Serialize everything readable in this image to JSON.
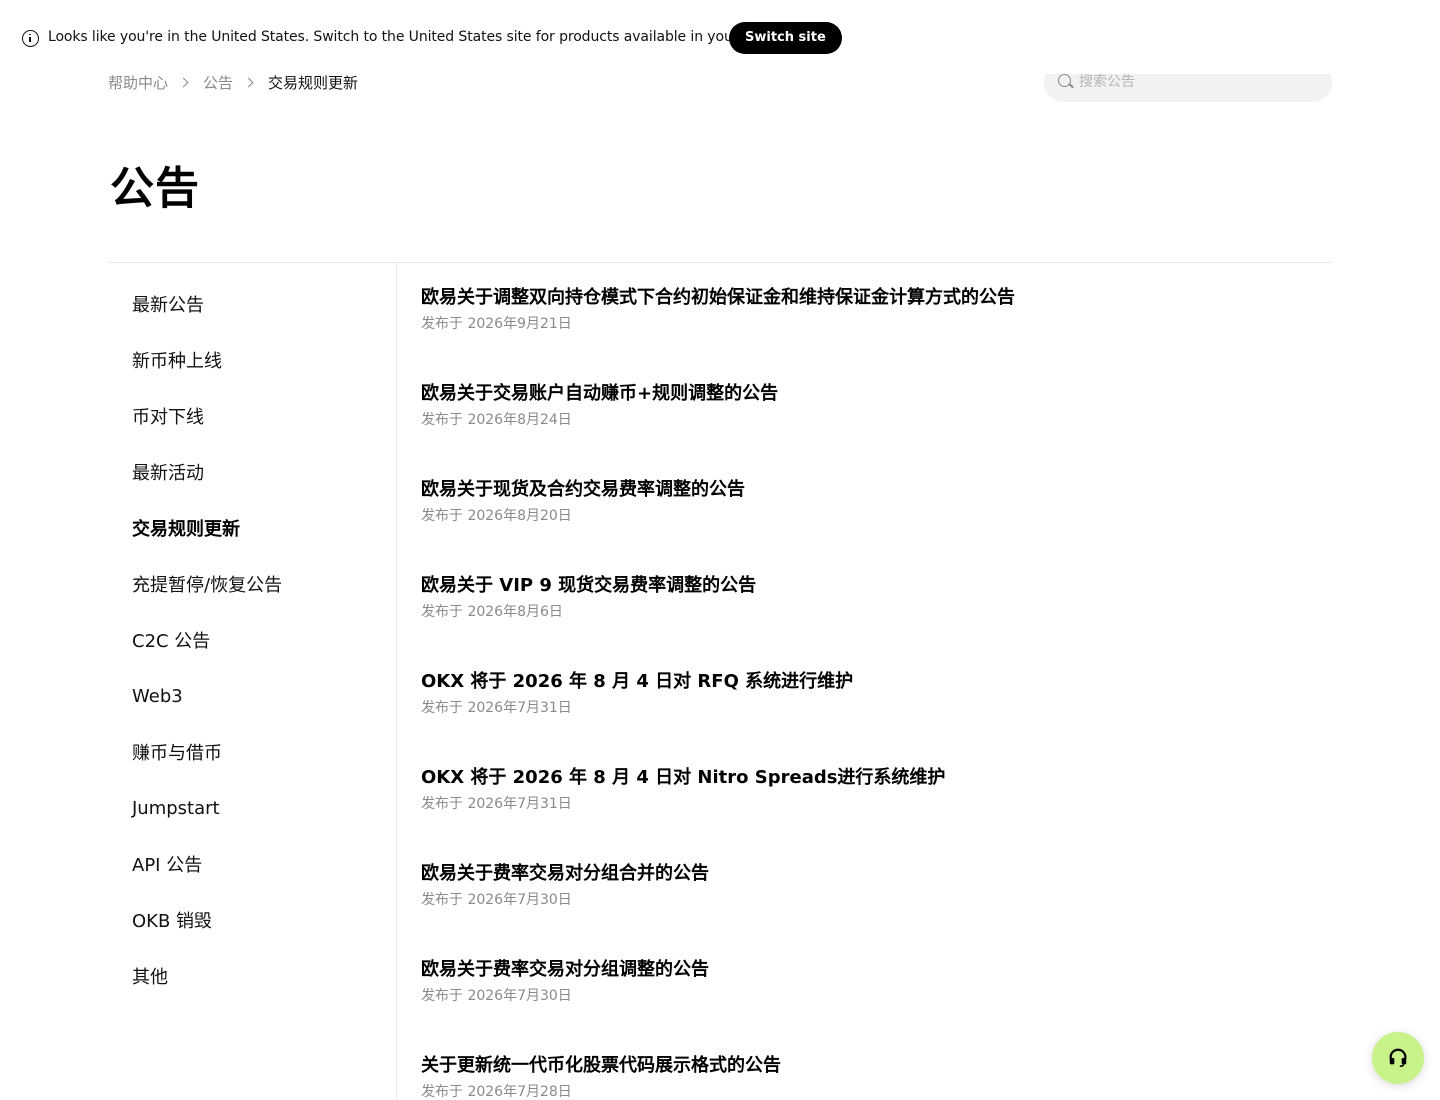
{
  "banner": {
    "text": "Looks like you're in the United States. Switch to the United States site for products available in your region.",
    "button_label": "Switch site",
    "icon": "info-icon"
  },
  "breadcrumb": {
    "items": [
      "帮助中心",
      "公告"
    ],
    "current": "交易规则更新"
  },
  "search": {
    "placeholder": "搜索公告",
    "icon": "search-icon"
  },
  "page_title": "公告",
  "sidebar": {
    "items": [
      {
        "label": "最新公告"
      },
      {
        "label": "新币种上线"
      },
      {
        "label": "币对下线"
      },
      {
        "label": "最新活动"
      },
      {
        "label": "交易规则更新",
        "active": true
      },
      {
        "label": "充提暂停/恢复公告"
      },
      {
        "label": "C2C 公告"
      },
      {
        "label": "Web3"
      },
      {
        "label": "赚币与借币"
      },
      {
        "label": "Jumpstart"
      },
      {
        "label": "API 公告"
      },
      {
        "label": "OKB 销毁"
      },
      {
        "label": "其他"
      }
    ]
  },
  "announcements": [
    {
      "title": "欧易关于调整双向持仓模式下合约初始保证金和维持保证金计算方式的公告",
      "date": "发布于 2026年9月21日"
    },
    {
      "title": "欧易关于交易账户自动赚币+规则调整的公告",
      "date": "发布于 2026年8月24日"
    },
    {
      "title": "欧易关于现货及合约交易费率调整的公告",
      "date": "发布于 2026年8月20日"
    },
    {
      "title": "欧易关于 VIP 9 现货交易费率调整的公告",
      "date": "发布于 2026年8月6日"
    },
    {
      "title": "OKX 将于 2026 年 8 月 4 日对 RFQ 系统进行维护",
      "date": "发布于 2026年7月31日"
    },
    {
      "title": "OKX 将于 2026 年 8 月 4 日对 Nitro Spreads进行系统维护",
      "date": "发布于 2026年7月31日"
    },
    {
      "title": "欧易关于费率交易对分组合并的公告",
      "date": "发布于 2026年7月30日"
    },
    {
      "title": "欧易关于费率交易对分组调整的公告",
      "date": "发布于 2026年7月30日"
    },
    {
      "title": "关于更新统一代币化股票代码展示格式的公告",
      "date": "发布于 2026年7月28日"
    }
  ],
  "support": {
    "icon": "headset-icon",
    "color": "#c8f28a"
  },
  "colors": {
    "accent_button": "#000000",
    "muted_text": "#8a8a8a",
    "support_bg": "#c8f28a"
  }
}
